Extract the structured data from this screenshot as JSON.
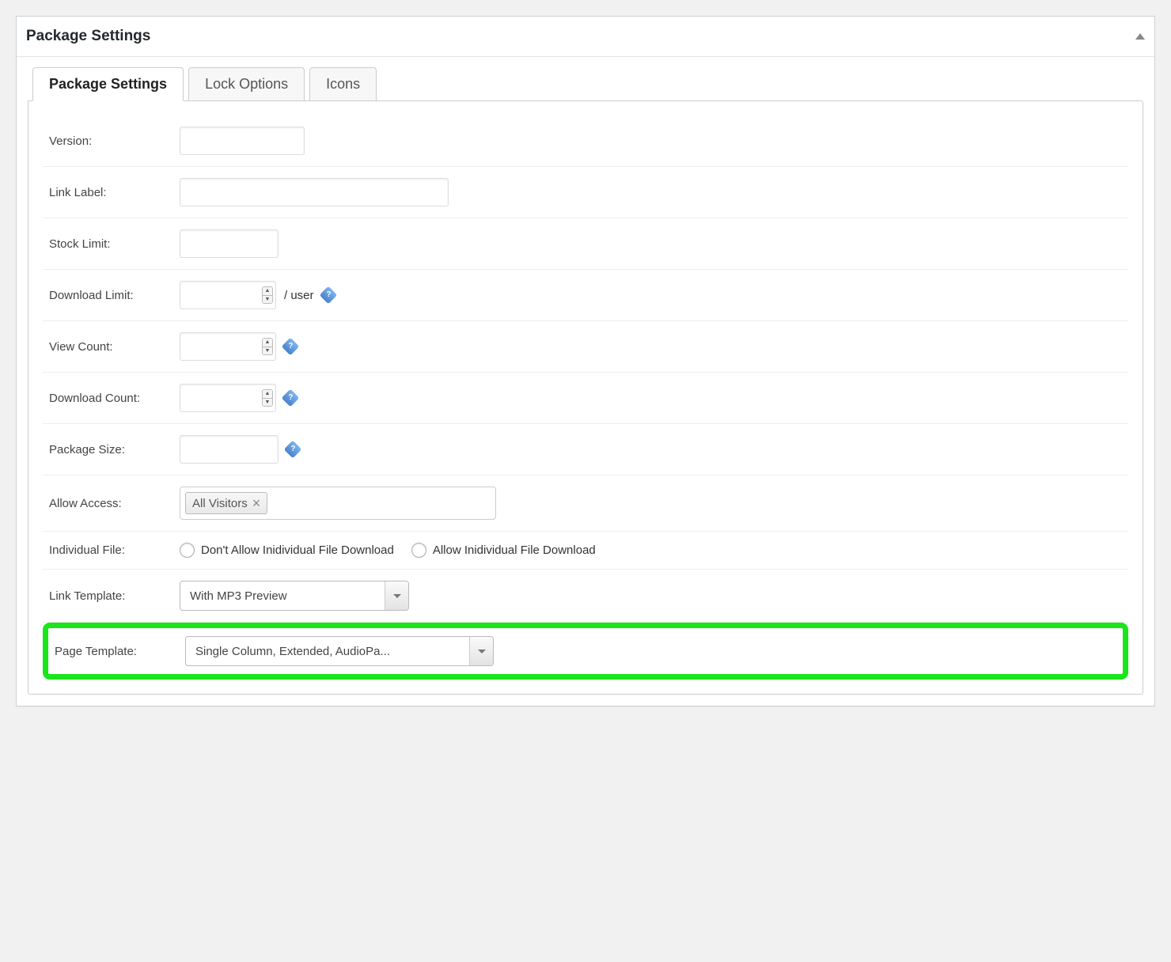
{
  "metabox": {
    "title": "Package Settings"
  },
  "tabs": [
    {
      "label": "Package Settings"
    },
    {
      "label": "Lock Options"
    },
    {
      "label": "Icons"
    }
  ],
  "fields": {
    "version": {
      "label": "Version:",
      "value": ""
    },
    "link_label": {
      "label": "Link Label:",
      "value": ""
    },
    "stock_limit": {
      "label": "Stock Limit:",
      "value": ""
    },
    "download_limit": {
      "label": "Download Limit:",
      "value": "",
      "suffix": "/ user"
    },
    "view_count": {
      "label": "View Count:",
      "value": ""
    },
    "download_count": {
      "label": "Download Count:",
      "value": ""
    },
    "package_size": {
      "label": "Package Size:",
      "value": ""
    },
    "allow_access": {
      "label": "Allow Access:",
      "tag": "All Visitors"
    },
    "individual_file": {
      "label": "Individual File:",
      "opt1": "Don't Allow Inidividual File Download",
      "opt2": "Allow Inidividual File Download"
    },
    "link_template": {
      "label": "Link Template:",
      "selected": "With MP3 Preview"
    },
    "page_template": {
      "label": "Page Template:",
      "selected": "Single Column, Extended, AudioPa..."
    }
  }
}
